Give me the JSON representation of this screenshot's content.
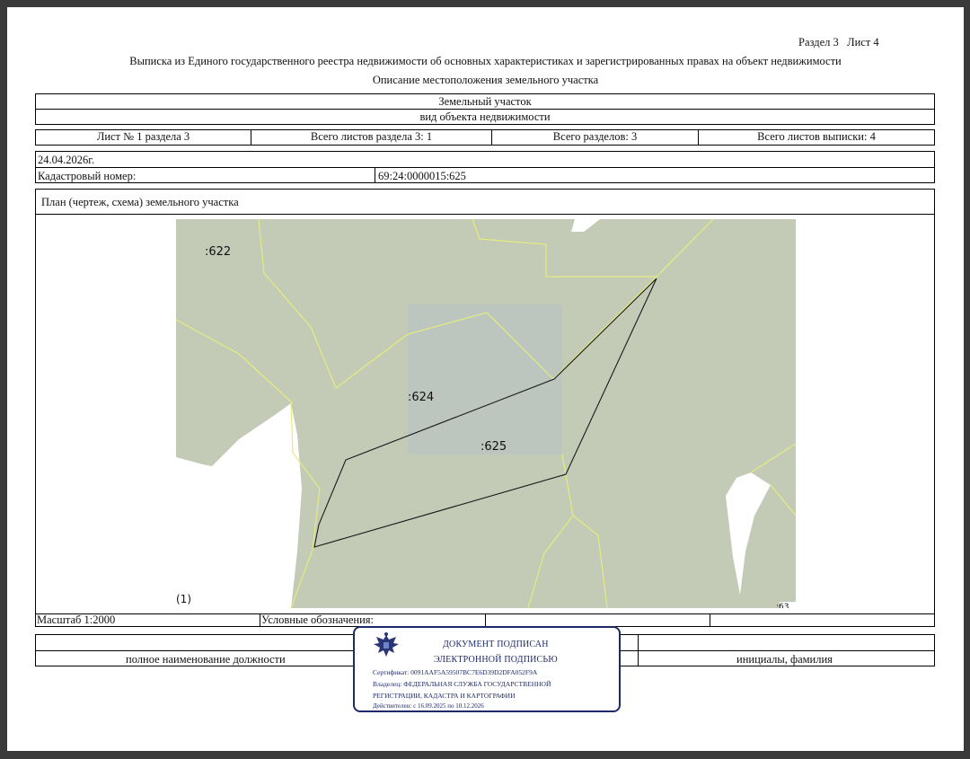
{
  "header": {
    "section_sheet": "Раздел 3   Лист 4",
    "title": "Выписка из Единого государственного реестра недвижимости об основных характеристиках и зарегистрированных правах на объект недвижимости",
    "subtitle": "Описание местоположения земельного участка"
  },
  "object": {
    "type": "Земельный участок",
    "type_caption": "вид объекта недвижимости"
  },
  "sheets": {
    "sheet": "Лист № 1 раздела 3",
    "total_section_sheets": "Всего листов раздела 3: 1",
    "total_sections": "Всего разделов: 3",
    "total_extract_sheets": "Всего листов выписки: 4"
  },
  "date": "24.04.2026г.",
  "cadastral": {
    "label": "Кадастровый номер:",
    "value": "69:24:0000015:625"
  },
  "plan": {
    "title": "План (чертеж, схема) земельного участка",
    "labels": {
      "p622": ":622",
      "p624": ":624",
      "p625": ":625",
      "corner": "(1)",
      "partial": ":63"
    },
    "colors": {
      "land": "#c3cbb7",
      "highlight": "#bcc4c0",
      "boundary": "#e4ec7e",
      "target": "#1a1a1a"
    }
  },
  "footer": {
    "scale": "Масштаб 1:2000",
    "legend": "Условные обозначения:",
    "position_caption": "полное наименование должности",
    "initials_caption": "инициалы, фамилия"
  },
  "signature": {
    "line1": "ДОКУМЕНТ ПОДПИСАН",
    "line2": "ЭЛЕКТРОННОЙ ПОДПИСЬЮ",
    "certificate": "Сертификат: 0091AAF5A59507BC7E6D39D2DFA052F9A",
    "owner_line1": "Владелец: ФЕДЕРАЛЬНАЯ СЛУЖБА ГОСУДАРСТВЕННОЙ",
    "owner_line2": "РЕГИСТРАЦИИ, КАДАСТРА И КАРТОГРАФИИ",
    "valid": "Действителен: с 16.09.2025 по 10.12.2026",
    "emblem_icon": "eagle-emblem-icon"
  }
}
